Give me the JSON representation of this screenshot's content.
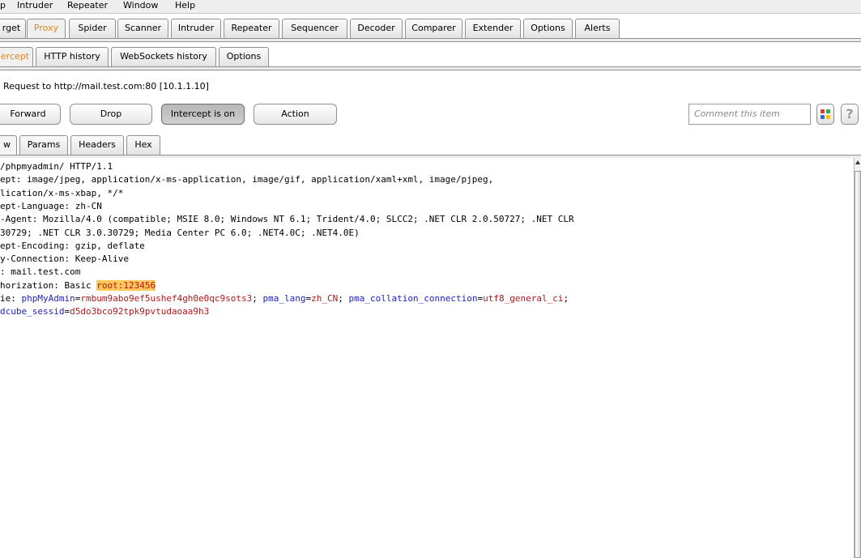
{
  "menu": [
    "p",
    "Intruder",
    "Repeater",
    "Window",
    "Help"
  ],
  "main_tabs": [
    "rget",
    "Proxy",
    "Spider",
    "Scanner",
    "Intruder",
    "Repeater",
    "Sequencer",
    "Decoder",
    "Comparer",
    "Extender",
    "Options",
    "Alerts"
  ],
  "main_tab_active": "Proxy",
  "proxy_tabs": [
    "ercept",
    "HTTP history",
    "WebSockets history",
    "Options"
  ],
  "proxy_tab_active": "ercept",
  "request_info": "Request to http://mail.test.com:80  [10.1.1.10]",
  "buttons": {
    "forward": "Forward",
    "drop": "Drop",
    "intercept": "Intercept is on",
    "action": "Action"
  },
  "comment_placeholder": "Comment this item",
  "help_icon": "?",
  "view_tabs": [
    "w",
    "Params",
    "Headers",
    "Hex"
  ],
  "view_tab_active": "w",
  "request_lines": [
    [
      {
        "t": "/phpmyadmin/ HTTP/1.1"
      }
    ],
    [
      {
        "t": "ept: image/jpeg, application/x-ms-application, image/gif, application/xaml+xml, image/pjpeg,"
      }
    ],
    [
      {
        "t": "lication/x-ms-xbap, */*"
      }
    ],
    [
      {
        "t": "ept-Language: zh-CN"
      }
    ],
    [
      {
        "t": "-Agent: Mozilla/4.0 (compatible; MSIE 8.0; Windows NT 6.1; Trident/4.0; SLCC2; .NET CLR 2.0.50727; .NET CLR"
      }
    ],
    [
      {
        "t": "30729; .NET CLR 3.0.30729; Media Center PC 6.0; .NET4.0C; .NET4.0E)"
      }
    ],
    [
      {
        "t": "ept-Encoding: gzip, deflate"
      }
    ],
    [
      {
        "t": "y-Connection: Keep-Alive"
      }
    ],
    [
      {
        "t": ": mail.test.com"
      }
    ],
    [
      {
        "t": "horization: Basic "
      },
      {
        "t": "root:123456",
        "c": "hl"
      }
    ],
    [
      {
        "t": "ie: "
      },
      {
        "t": "phpMyAdmin",
        "c": "pname"
      },
      {
        "t": "="
      },
      {
        "t": "rmbum9abo9ef5ushef4gh0e0qc9sots3",
        "c": "pval"
      },
      {
        "t": "; "
      },
      {
        "t": "pma_lang",
        "c": "pname"
      },
      {
        "t": "="
      },
      {
        "t": "zh_CN",
        "c": "pval"
      },
      {
        "t": "; "
      },
      {
        "t": "pma_collation_connection",
        "c": "pname"
      },
      {
        "t": "="
      },
      {
        "t": "utf8_general_ci",
        "c": "pval"
      },
      {
        "t": ";"
      }
    ],
    [
      {
        "t": "dcube_sessid",
        "c": "pname"
      },
      {
        "t": "="
      },
      {
        "t": "d5do3bco92tpk9pvtudaoaa9h3",
        "c": "pval"
      }
    ]
  ],
  "colors": {
    "active_tab_text": "#e8811c",
    "param_name": "#2020c8",
    "param_value": "#b01818",
    "highlight": "#ffc75a",
    "icon_red": "#e03a2a",
    "icon_green": "#3aa64a",
    "icon_blue": "#2f6fd8",
    "icon_yellow": "#f0c020"
  }
}
